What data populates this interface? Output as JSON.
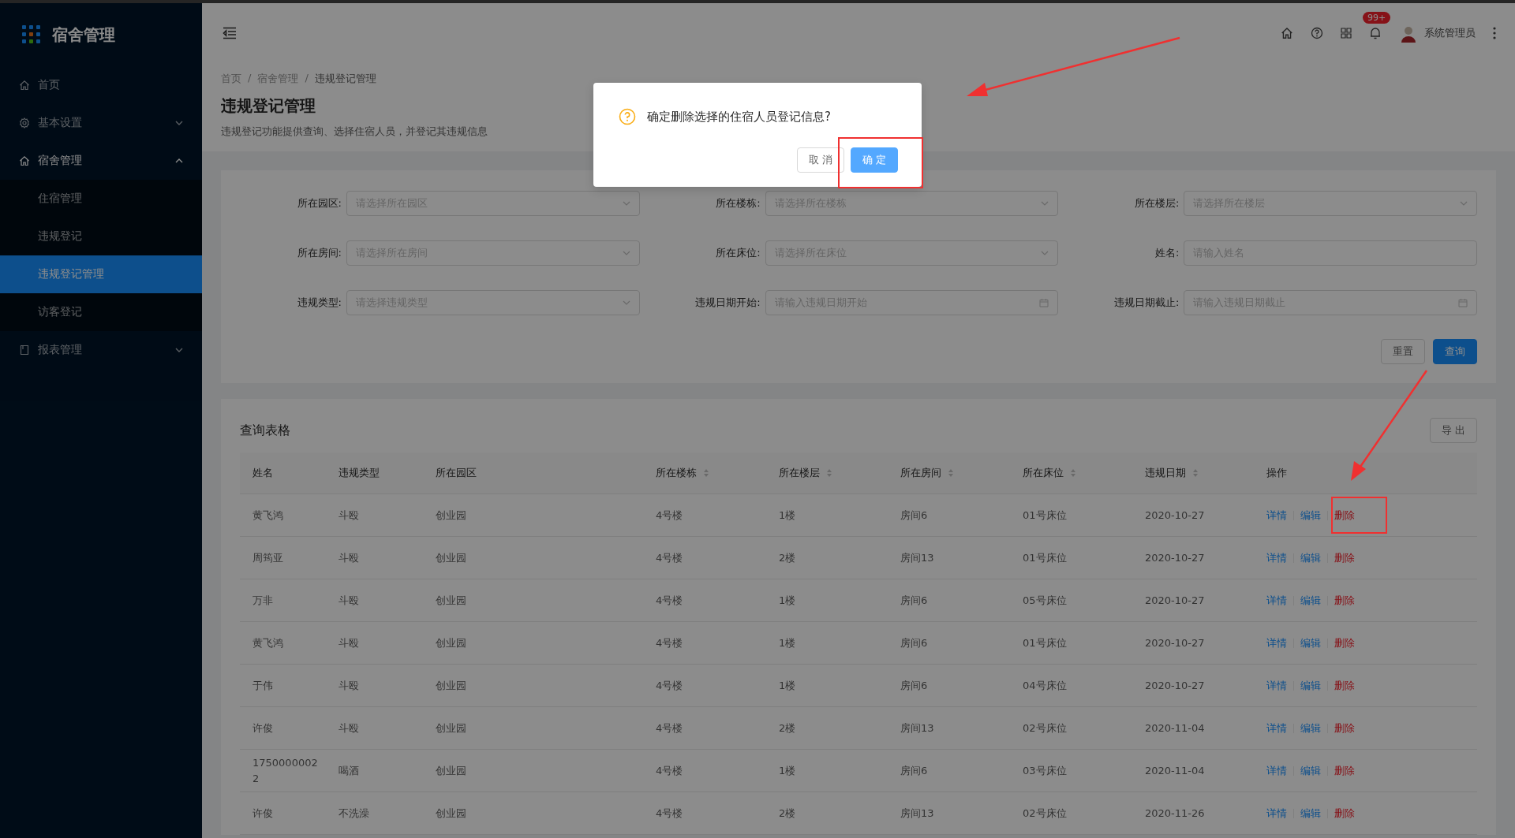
{
  "app": {
    "title": "宿舍管理"
  },
  "sidebar": {
    "items": [
      {
        "label": "首页",
        "selected": false
      },
      {
        "label": "基本设置",
        "selected": false,
        "expanded": false
      },
      {
        "label": "宿舍管理",
        "selected": false,
        "expanded": true,
        "children": [
          {
            "label": "住宿管理",
            "selected": false
          },
          {
            "label": "违规登记",
            "selected": false
          },
          {
            "label": "违规登记管理",
            "selected": true
          },
          {
            "label": "访客登记",
            "selected": false
          }
        ]
      },
      {
        "label": "报表管理",
        "selected": false,
        "expanded": false
      }
    ]
  },
  "header": {
    "badge": "99+",
    "user": "系统管理员"
  },
  "breadcrumb": {
    "separator": "/",
    "items": [
      "首页",
      "宿舍管理",
      "违规登记管理"
    ]
  },
  "page": {
    "title": "违规登记管理",
    "description": "违规登记功能提供查询、选择住宿人员，并登记其违规信息"
  },
  "filters": [
    {
      "label": "所在园区:",
      "placeholder": "请选择所在园区",
      "kind": "select"
    },
    {
      "label": "所在楼栋:",
      "placeholder": "请选择所在楼栋",
      "kind": "select"
    },
    {
      "label": "所在楼层:",
      "placeholder": "请选择所在楼层",
      "kind": "select"
    },
    {
      "label": "所在房间:",
      "placeholder": "请选择所在房间",
      "kind": "select"
    },
    {
      "label": "所在床位:",
      "placeholder": "请选择所在床位",
      "kind": "select"
    },
    {
      "label": "姓名:",
      "placeholder": "请输入姓名",
      "kind": "input"
    },
    {
      "label": "违规类型:",
      "placeholder": "请选择违规类型",
      "kind": "select"
    },
    {
      "label": "违规日期开始:",
      "placeholder": "请输入违规日期开始",
      "kind": "date"
    },
    {
      "label": "违规日期截止:",
      "placeholder": "请输入违规日期截止",
      "kind": "date"
    }
  ],
  "filter_buttons": [
    {
      "label": "重置",
      "primary": false
    },
    {
      "label": "查询",
      "primary": true
    }
  ],
  "table": {
    "title": "查询表格",
    "export": "导 出",
    "columns": [
      {
        "label": "姓名",
        "sortable": false
      },
      {
        "label": "违规类型",
        "sortable": false
      },
      {
        "label": "所在园区",
        "sortable": false
      },
      {
        "label": "所在楼栋",
        "sortable": true
      },
      {
        "label": "所在楼层",
        "sortable": true
      },
      {
        "label": "所在房间",
        "sortable": true
      },
      {
        "label": "所在床位",
        "sortable": true
      },
      {
        "label": "违规日期",
        "sortable": true
      },
      {
        "label": "操作",
        "sortable": false
      }
    ],
    "rows": [
      {
        "cells": [
          "黄飞鸿",
          "斗殴",
          "创业园",
          "4号楼",
          "1楼",
          "房间6",
          "01号床位",
          "2020-10-27"
        ],
        "actions": [
          {
            "label": "详情",
            "kind": "link"
          },
          {
            "label": "编辑",
            "kind": "link"
          },
          {
            "label": "删除",
            "kind": "danger"
          }
        ]
      },
      {
        "cells": [
          "周筠亚",
          "斗殴",
          "创业园",
          "4号楼",
          "2楼",
          "房间13",
          "01号床位",
          "2020-10-27"
        ],
        "actions": [
          {
            "label": "详情",
            "kind": "link"
          },
          {
            "label": "编辑",
            "kind": "link"
          },
          {
            "label": "删除",
            "kind": "danger"
          }
        ]
      },
      {
        "cells": [
          "万非",
          "斗殴",
          "创业园",
          "4号楼",
          "1楼",
          "房间6",
          "05号床位",
          "2020-10-27"
        ],
        "actions": [
          {
            "label": "详情",
            "kind": "link"
          },
          {
            "label": "编辑",
            "kind": "link"
          },
          {
            "label": "删除",
            "kind": "danger"
          }
        ]
      },
      {
        "cells": [
          "黄飞鸿",
          "斗殴",
          "创业园",
          "4号楼",
          "1楼",
          "房间6",
          "01号床位",
          "2020-10-27"
        ],
        "actions": [
          {
            "label": "详情",
            "kind": "link"
          },
          {
            "label": "编辑",
            "kind": "link"
          },
          {
            "label": "删除",
            "kind": "danger"
          }
        ]
      },
      {
        "cells": [
          "于伟",
          "斗殴",
          "创业园",
          "4号楼",
          "1楼",
          "房间6",
          "04号床位",
          "2020-10-27"
        ],
        "actions": [
          {
            "label": "详情",
            "kind": "link"
          },
          {
            "label": "编辑",
            "kind": "link"
          },
          {
            "label": "删除",
            "kind": "danger"
          }
        ]
      },
      {
        "cells": [
          "许俊",
          "斗殴",
          "创业园",
          "4号楼",
          "2楼",
          "房间13",
          "02号床位",
          "2020-11-04"
        ],
        "actions": [
          {
            "label": "详情",
            "kind": "link"
          },
          {
            "label": "编辑",
            "kind": "link"
          },
          {
            "label": "删除",
            "kind": "danger"
          }
        ]
      },
      {
        "cells": [
          "17500000022",
          "喝酒",
          "创业园",
          "4号楼",
          "1楼",
          "房间6",
          "03号床位",
          "2020-11-04"
        ],
        "actions": [
          {
            "label": "详情",
            "kind": "link"
          },
          {
            "label": "编辑",
            "kind": "link"
          },
          {
            "label": "删除",
            "kind": "danger"
          }
        ]
      },
      {
        "cells": [
          "许俊",
          "不洗澡",
          "创业园",
          "4号楼",
          "2楼",
          "房间13",
          "02号床位",
          "2020-11-26"
        ],
        "actions": [
          {
            "label": "详情",
            "kind": "link"
          },
          {
            "label": "编辑",
            "kind": "link"
          },
          {
            "label": "删除",
            "kind": "danger"
          }
        ]
      }
    ]
  },
  "dialog": {
    "message": "确定删除选择的住宿人员登记信息?",
    "buttons": [
      {
        "label": "取 消",
        "primary": false
      },
      {
        "label": "确 定",
        "primary": true
      }
    ]
  }
}
